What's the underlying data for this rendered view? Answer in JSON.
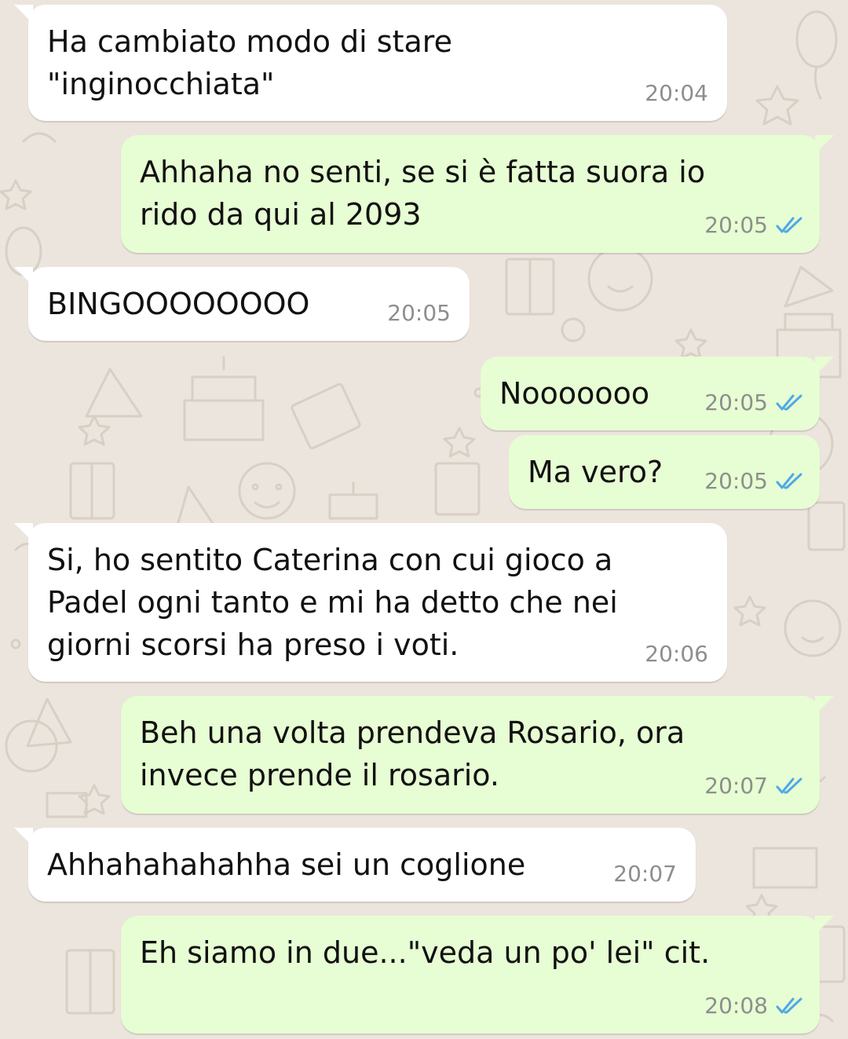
{
  "colors": {
    "background": "#ece5dd",
    "incoming_bubble": "#ffffff",
    "outgoing_bubble": "#e7fdd3",
    "timestamp": "#8c8f8c",
    "read_ticks": "#4fa9e6"
  },
  "messages": [
    {
      "direction": "incoming",
      "text": "Ha cambiato modo di stare\n\"inginocchiata\"",
      "time": "20:04"
    },
    {
      "direction": "outgoing",
      "text": "Ahhaha no senti, se si è fatta suora io\nrido da qui al 2093",
      "time": "20:05",
      "status": "read-double-check-icon"
    },
    {
      "direction": "incoming",
      "text": "BINGOOOOOOOO",
      "time": "20:05"
    },
    {
      "direction": "outgoing",
      "text": "Nooooooo",
      "time": "20:05",
      "status": "read-double-check-icon"
    },
    {
      "direction": "outgoing",
      "text": "Ma vero?",
      "time": "20:05",
      "status": "read-double-check-icon"
    },
    {
      "direction": "incoming",
      "text": "Si, ho sentito Caterina con cui gioco a\nPadel ogni tanto e mi ha detto che nei\ngiorni scorsi ha preso i voti.",
      "time": "20:06"
    },
    {
      "direction": "outgoing",
      "text": "Beh una volta prendeva Rosario, ora\ninvece prende il rosario.",
      "time": "20:07",
      "status": "read-double-check-icon"
    },
    {
      "direction": "incoming",
      "text": "Ahhahahahahha sei un coglione",
      "time": "20:07"
    },
    {
      "direction": "outgoing",
      "text": "Eh siamo in due...\"veda un po' lei\" cit.",
      "time": "20:08",
      "status": "read-double-check-icon"
    }
  ]
}
